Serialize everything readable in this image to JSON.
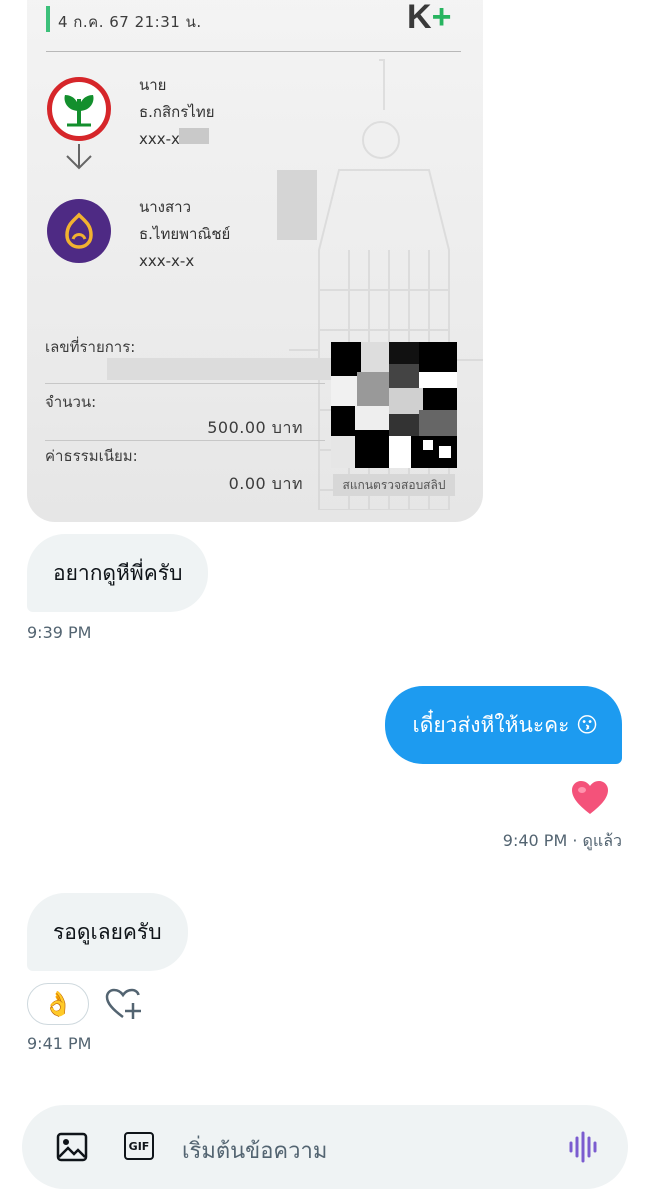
{
  "slip": {
    "date": "4 ก.ค. 67  21:31 น.",
    "brand": "K",
    "brand_plus": "+",
    "from": {
      "title": "นาย",
      "bank": "ธ.กสิกรไทย",
      "account": "xxx-x"
    },
    "to": {
      "title": "นางสาว",
      "bank": "ธ.ไทยพาณิชย์",
      "account": "xxx-x-x"
    },
    "ref_label": "เลขที่รายการ:",
    "amount_label": "จำนวน:",
    "amount_value": "500.00 บาท",
    "fee_label": "ค่าธรรมเนียม:",
    "fee_value": "0.00 บาท",
    "verify_label": "สแกนตรวจสอบสลิป"
  },
  "messages": {
    "m1": {
      "text": "อยากดูหีพี่ครับ",
      "time": "9:39 PM"
    },
    "m2": {
      "text": "เดี๋ยวส่งหีให้นะคะ 😗",
      "status": "9:40 PM · ดูแล้ว",
      "reaction": "heart"
    },
    "m3": {
      "text": "รอดูเลยครับ",
      "reaction": "👌",
      "time": "9:41 PM"
    }
  },
  "composer": {
    "placeholder": "เริ่มต้นข้อความ",
    "gif_label": "GIF",
    "icons": [
      "image-icon",
      "gif-icon",
      "voice-icon"
    ]
  },
  "colors": {
    "accent": "#1d9bf0",
    "bubble_in": "#eff3f4",
    "kbank_green": "#138f2d",
    "scb_purple": "#4e2a84"
  }
}
